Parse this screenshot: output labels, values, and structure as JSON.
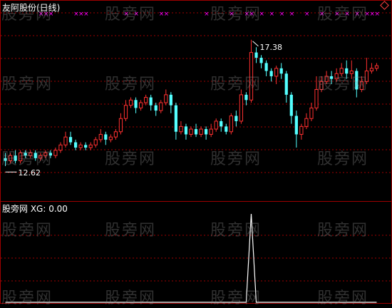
{
  "window": {
    "main_title": "友阿股份(日线)",
    "sub_title": "股旁网 XG: 0.00",
    "watermark": "股旁网"
  },
  "colors": {
    "background": "#000000",
    "frame": "#a00000",
    "up_candle": "#ff3030",
    "down_candle": "#54ffff",
    "grid": "#a00000",
    "signal_marker": "#ff00ff",
    "indicator_line": "#ffffff"
  },
  "chart_data": [
    {
      "type": "candlestick",
      "title": "友阿股份(日线)",
      "ylim": [
        11.6,
        18.4
      ],
      "grid": "dotted horizontal",
      "annotations": [
        {
          "label": "17.38",
          "value": 17.38,
          "kind": "high"
        },
        {
          "label": "12.62",
          "value": 12.62,
          "kind": "low"
        }
      ],
      "candles": [
        [
          12.9,
          12.8,
          13.1,
          12.6
        ],
        [
          12.8,
          13.0,
          13.1,
          12.7
        ],
        [
          13.0,
          12.8,
          13.2,
          12.7
        ],
        [
          12.8,
          13.1,
          13.2,
          12.7
        ],
        [
          13.1,
          13.0,
          13.2,
          12.9
        ],
        [
          13.0,
          13.1,
          13.2,
          12.9
        ],
        [
          13.1,
          12.9,
          13.2,
          12.8
        ],
        [
          12.9,
          13.0,
          13.1,
          12.8
        ],
        [
          13.0,
          13.1,
          13.2,
          12.9
        ],
        [
          13.1,
          13.0,
          13.2,
          12.9
        ],
        [
          13.0,
          13.2,
          13.3,
          12.9
        ],
        [
          13.2,
          13.4,
          13.5,
          13.1
        ],
        [
          13.4,
          13.7,
          13.9,
          13.3
        ],
        [
          13.7,
          13.5,
          13.9,
          13.4
        ],
        [
          13.5,
          13.3,
          13.6,
          13.2
        ],
        [
          13.3,
          13.4,
          13.5,
          13.2
        ],
        [
          13.4,
          13.3,
          13.5,
          13.2
        ],
        [
          13.3,
          13.4,
          13.5,
          13.2
        ],
        [
          13.4,
          13.6,
          13.7,
          13.3
        ],
        [
          13.6,
          13.8,
          14.0,
          13.5
        ],
        [
          13.8,
          13.6,
          13.9,
          13.4
        ],
        [
          13.6,
          13.7,
          13.8,
          13.5
        ],
        [
          13.7,
          13.9,
          14.0,
          13.6
        ],
        [
          13.9,
          14.4,
          14.6,
          13.8
        ],
        [
          14.4,
          14.9,
          15.1,
          14.3
        ],
        [
          14.9,
          15.1,
          15.2,
          14.8
        ],
        [
          15.1,
          14.8,
          15.2,
          14.6
        ],
        [
          14.8,
          15.0,
          15.1,
          14.7
        ],
        [
          15.0,
          15.2,
          15.3,
          14.9
        ],
        [
          15.2,
          14.9,
          15.3,
          14.7
        ],
        [
          14.9,
          14.7,
          15.0,
          14.5
        ],
        [
          14.7,
          15.0,
          15.1,
          14.6
        ],
        [
          15.0,
          15.3,
          15.5,
          14.9
        ],
        [
          15.3,
          14.9,
          15.4,
          14.6
        ],
        [
          14.9,
          13.9,
          15.0,
          13.6
        ],
        [
          13.9,
          14.1,
          14.3,
          13.8
        ],
        [
          14.1,
          13.8,
          14.2,
          13.6
        ],
        [
          13.8,
          14.0,
          14.1,
          13.7
        ],
        [
          14.0,
          13.8,
          14.2,
          13.7
        ],
        [
          13.8,
          14.0,
          14.1,
          13.7
        ],
        [
          14.0,
          13.8,
          14.1,
          13.6
        ],
        [
          13.8,
          14.0,
          14.2,
          13.7
        ],
        [
          14.0,
          14.3,
          14.4,
          13.9
        ],
        [
          14.3,
          14.1,
          14.4,
          13.9
        ],
        [
          14.1,
          13.9,
          14.2,
          13.8
        ],
        [
          13.9,
          14.5,
          14.6,
          13.8
        ],
        [
          14.5,
          14.3,
          14.7,
          14.1
        ],
        [
          14.3,
          15.3,
          15.5,
          14.2
        ],
        [
          15.3,
          15.1,
          15.4,
          14.9
        ],
        [
          15.1,
          16.9,
          17.38,
          15.0
        ],
        [
          16.9,
          16.7,
          17.1,
          16.5
        ],
        [
          16.7,
          16.5,
          16.8,
          16.3
        ],
        [
          16.5,
          16.2,
          16.6,
          16.0
        ],
        [
          16.2,
          16.0,
          16.3,
          15.8
        ],
        [
          16.0,
          16.3,
          16.4,
          15.7
        ],
        [
          16.3,
          16.1,
          16.5,
          15.9
        ],
        [
          16.1,
          15.3,
          16.2,
          15.0
        ],
        [
          15.3,
          14.5,
          15.4,
          14.2
        ],
        [
          14.5,
          13.8,
          14.7,
          13.3
        ],
        [
          13.8,
          14.1,
          14.2,
          13.6
        ],
        [
          14.1,
          14.4,
          14.6,
          14.0
        ],
        [
          14.4,
          14.8,
          15.0,
          14.3
        ],
        [
          14.8,
          15.5,
          16.0,
          14.7
        ],
        [
          15.5,
          15.8,
          16.0,
          15.4
        ],
        [
          15.8,
          16.0,
          16.2,
          15.7
        ],
        [
          16.0,
          15.9,
          16.2,
          15.7
        ],
        [
          15.9,
          16.1,
          16.3,
          15.8
        ],
        [
          16.1,
          16.3,
          16.5,
          16.0
        ],
        [
          16.3,
          16.1,
          16.6,
          15.9
        ],
        [
          16.1,
          16.2,
          16.6,
          15.9
        ],
        [
          16.2,
          15.5,
          16.3,
          15.2
        ],
        [
          15.5,
          15.8,
          16.0,
          15.4
        ],
        [
          15.8,
          16.2,
          16.7,
          15.7
        ],
        [
          16.2,
          16.3,
          16.5,
          16.1
        ],
        [
          16.3,
          16.4,
          16.5,
          16.2
        ]
      ]
    },
    {
      "type": "line",
      "series": [
        {
          "name": "XG",
          "current": 0.0
        }
      ],
      "ylim": [
        0,
        1
      ],
      "values": [
        0,
        0,
        0,
        0,
        0,
        0,
        0,
        0,
        0,
        0,
        0,
        0,
        0,
        0,
        0,
        0,
        0,
        0,
        0,
        0,
        0,
        0,
        0,
        0,
        0,
        0,
        0,
        0,
        0,
        0,
        0,
        0,
        0,
        0,
        0,
        0,
        0,
        0,
        0,
        0,
        0,
        0,
        0,
        0,
        0,
        0,
        0,
        0,
        0,
        1,
        0,
        0,
        0,
        0,
        0,
        0,
        0,
        0,
        0,
        0,
        0,
        0,
        0,
        0,
        0,
        0,
        0,
        0,
        0,
        0,
        0,
        0,
        0,
        0,
        0
      ]
    }
  ]
}
